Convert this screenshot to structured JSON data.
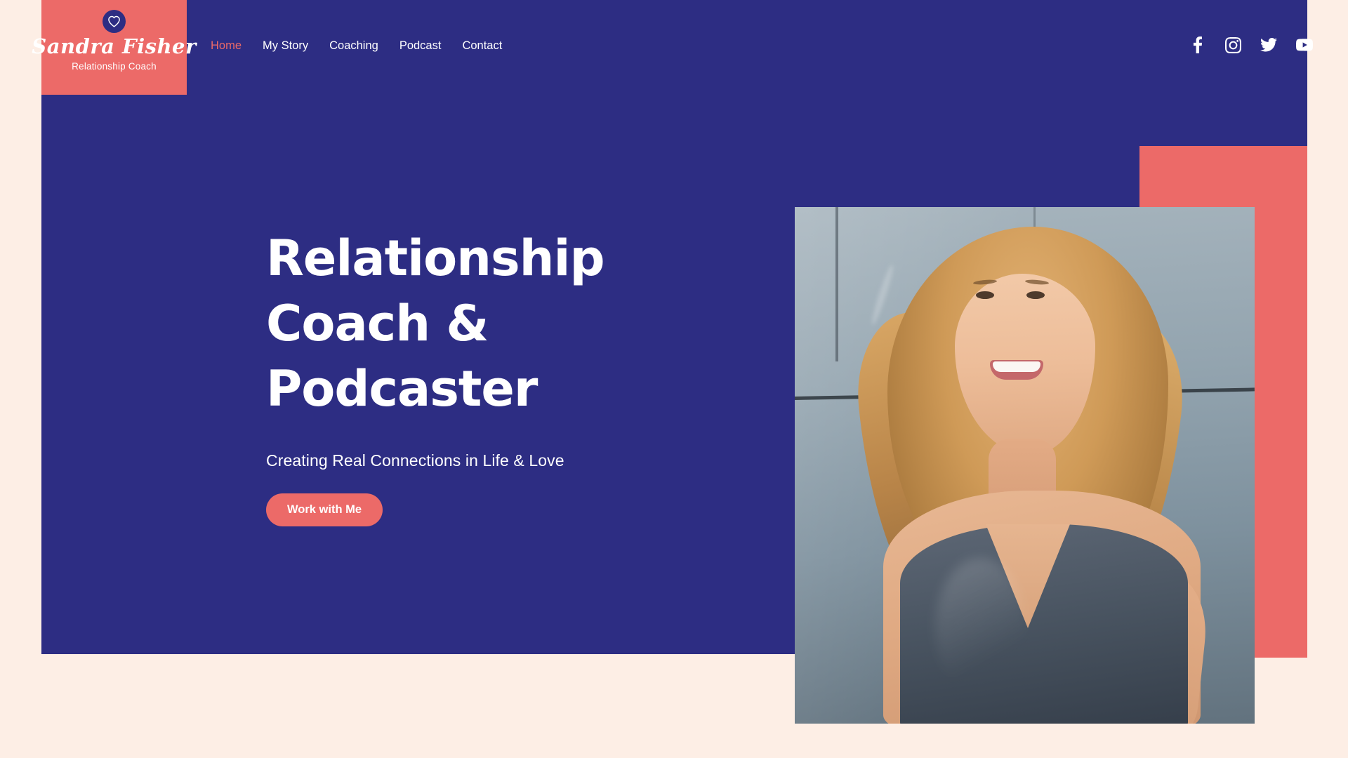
{
  "theme": {
    "navy": "#2d2d83",
    "coral": "#ec6a68",
    "background": "#fdeee5",
    "text_light": "#ffffff"
  },
  "logo": {
    "badge_icon": "heart-icon",
    "name": "Sandra Fisher",
    "tagline": "Relationship Coach"
  },
  "nav": {
    "items": [
      {
        "label": "Home",
        "active": true
      },
      {
        "label": "My Story",
        "active": false
      },
      {
        "label": "Coaching",
        "active": false
      },
      {
        "label": "Podcast",
        "active": false
      },
      {
        "label": "Contact",
        "active": false
      }
    ]
  },
  "social": {
    "items": [
      {
        "name": "facebook-icon",
        "label": "Facebook"
      },
      {
        "name": "instagram-icon",
        "label": "Instagram"
      },
      {
        "name": "twitter-icon",
        "label": "Twitter"
      },
      {
        "name": "youtube-icon",
        "label": "YouTube"
      }
    ]
  },
  "hero": {
    "title_line1": "Relationship",
    "title_line2": "Coach &",
    "title_line3": "Podcaster",
    "subtitle": "Creating Real Connections in Life & Love",
    "cta_label": "Work with Me",
    "portrait_alt": "Portrait of Sandra Fisher smiling in front of a stone wall"
  }
}
